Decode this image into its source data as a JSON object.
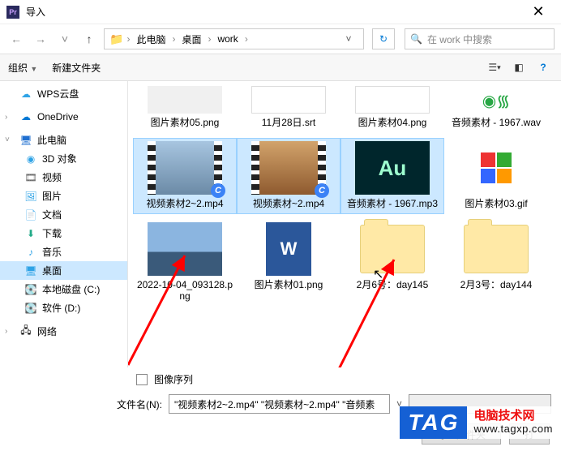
{
  "window": {
    "title": "导入",
    "app_icon_text": "Pr"
  },
  "breadcrumb": {
    "seg1": "此电脑",
    "seg2": "桌面",
    "seg3": "work"
  },
  "search": {
    "placeholder": "在 work 中搜索"
  },
  "toolbar": {
    "organize": "组织",
    "new_folder": "新建文件夹"
  },
  "sidebar": {
    "items": [
      {
        "label": "WPS云盘",
        "icon_color": "#2fa3e6"
      },
      {
        "label": "OneDrive",
        "icon_color": "#0078d4"
      },
      {
        "label": "此电脑",
        "icon_color": "#1f6fd0"
      },
      {
        "label": "3D 对象",
        "icon_color": "#2fa3e6"
      },
      {
        "label": "视频",
        "icon_color": "#555"
      },
      {
        "label": "图片",
        "icon_color": "#2fa3e6"
      },
      {
        "label": "文档",
        "icon_color": "#2fa3e6"
      },
      {
        "label": "下载",
        "icon_color": "#2a8"
      },
      {
        "label": "音乐",
        "icon_color": "#2fa3e6"
      },
      {
        "label": "桌面",
        "icon_color": "#2fa3e6"
      },
      {
        "label": "本地磁盘 (C:)",
        "icon_color": "#888"
      },
      {
        "label": "软件 (D:)",
        "icon_color": "#888"
      },
      {
        "label": "网络",
        "icon_color": "#888"
      }
    ]
  },
  "files": {
    "row0": [
      {
        "label": "图片素材05.png"
      },
      {
        "label": "11月28日.srt"
      },
      {
        "label": "图片素材04.png"
      },
      {
        "label": "音频素材 - 1967.wav"
      }
    ],
    "row1": [
      {
        "label": "视频素材2~2.mp4",
        "selected": true
      },
      {
        "label": "视频素材~2.mp4",
        "selected": true
      },
      {
        "label": "音频素材 - 1967.mp3",
        "selected": true
      },
      {
        "label": "图片素材03.gif",
        "selected": false
      }
    ],
    "row2": [
      {
        "label": "2022-10-04_093128.png"
      },
      {
        "label": "图片素材01.png"
      },
      {
        "label": "2月6号：day145"
      },
      {
        "label": "2月3号：day144"
      }
    ]
  },
  "options": {
    "image_sequence": "图像序列"
  },
  "filename": {
    "label": "文件名(N):",
    "value": "\"视频素材2~2.mp4\" \"视频素材~2.mp4\" \"音频素"
  },
  "filter": {
    "text": ""
  },
  "buttons": {
    "import": "导入文件夹",
    "open": "打"
  },
  "watermark": {
    "tag": "TAG",
    "cn": "电脑技术网",
    "url": "www.tagxp.com"
  }
}
